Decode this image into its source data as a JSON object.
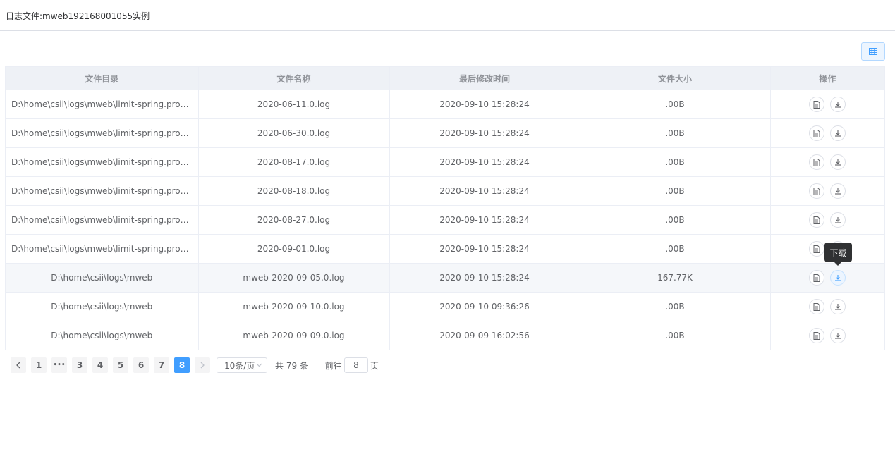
{
  "header": {
    "title": "日志文件:mweb192168001055实例"
  },
  "toolbar": {
    "icon": "table-grid-icon"
  },
  "table": {
    "columns": [
      "文件目录",
      "文件名称",
      "最后修改时间",
      "文件大小",
      "操作"
    ],
    "rows": [
      {
        "dir": "D:\\home\\csii\\logs\\mweb\\limit-spring.profiles.active_IS_UNDEFINED",
        "name": "2020-06-11.0.log",
        "modified": "2020-09-10 15:28:24",
        "size": ".00B"
      },
      {
        "dir": "D:\\home\\csii\\logs\\mweb\\limit-spring.profiles.active_IS_UNDEFINED",
        "name": "2020-06-30.0.log",
        "modified": "2020-09-10 15:28:24",
        "size": ".00B"
      },
      {
        "dir": "D:\\home\\csii\\logs\\mweb\\limit-spring.profiles.active_IS_UNDEFINED",
        "name": "2020-08-17.0.log",
        "modified": "2020-09-10 15:28:24",
        "size": ".00B"
      },
      {
        "dir": "D:\\home\\csii\\logs\\mweb\\limit-spring.profiles.active_IS_UNDEFINED",
        "name": "2020-08-18.0.log",
        "modified": "2020-09-10 15:28:24",
        "size": ".00B"
      },
      {
        "dir": "D:\\home\\csii\\logs\\mweb\\limit-spring.profiles.active_IS_UNDEFINED",
        "name": "2020-08-27.0.log",
        "modified": "2020-09-10 15:28:24",
        "size": ".00B"
      },
      {
        "dir": "D:\\home\\csii\\logs\\mweb\\limit-spring.profiles.active_IS_UNDEFINED",
        "name": "2020-09-01.0.log",
        "modified": "2020-09-10 15:28:24",
        "size": ".00B"
      },
      {
        "dir": "D:\\home\\csii\\logs\\mweb",
        "name": "mweb-2020-09-05.0.log",
        "modified": "2020-09-10 15:28:24",
        "size": "167.77K"
      },
      {
        "dir": "D:\\home\\csii\\logs\\mweb",
        "name": "mweb-2020-09-10.0.log",
        "modified": "2020-09-10 09:36:26",
        "size": ".00B"
      },
      {
        "dir": "D:\\home\\csii\\logs\\mweb",
        "name": "mweb-2020-09-09.0.log",
        "modified": "2020-09-09 16:02:56",
        "size": ".00B"
      }
    ],
    "actions": {
      "view_icon": "document-icon",
      "download_icon": "download-icon"
    }
  },
  "tooltip": {
    "text": "下载"
  },
  "pagination": {
    "prev": "‹",
    "pages": [
      "1",
      "•••",
      "3",
      "4",
      "5",
      "6",
      "7",
      "8"
    ],
    "current": "8",
    "next": "›",
    "page_size": "10条/页",
    "total": "共 79 条",
    "goto_prefix": "前往",
    "goto_value": "8",
    "goto_suffix": "页"
  },
  "colors": {
    "accent": "#409eff",
    "header_bg": "#eef1f6",
    "tooltip_bg": "#303133"
  }
}
